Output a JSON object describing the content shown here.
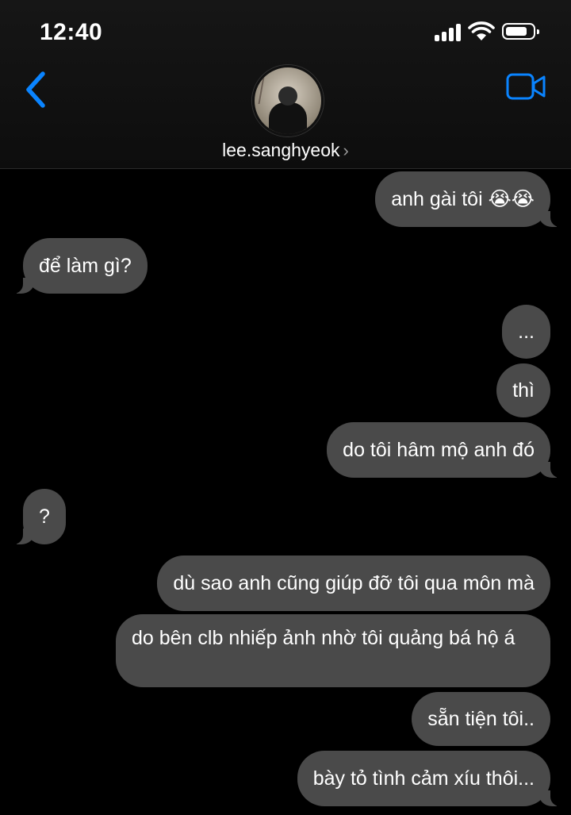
{
  "status_bar": {
    "time": "12:40"
  },
  "header": {
    "contact_name": "lee.sanghyeok",
    "chevron": "›"
  },
  "icons": {
    "back": "chevron-left-icon",
    "video": "video-camera-icon",
    "signal": "cellular-signal-icon",
    "wifi": "wifi-icon",
    "battery": "battery-icon"
  },
  "colors": {
    "accent": "#0a84ff",
    "bubble": "#4a4a4a",
    "background": "#000000"
  },
  "messages": [
    {
      "sender": "me",
      "text": "anh gài tôi 😭😭"
    },
    {
      "sender": "them",
      "text": "để làm gì?"
    },
    {
      "sender": "me",
      "text": "..."
    },
    {
      "sender": "me",
      "text": "thì"
    },
    {
      "sender": "me",
      "text": "do tôi hâm mộ anh đó"
    },
    {
      "sender": "them",
      "text": "?"
    },
    {
      "sender": "me",
      "text": "dù sao anh cũng giúp đỡ tôi qua môn mà"
    },
    {
      "sender": "me",
      "text": "do bên clb nhiếp ảnh nhờ tôi quảng bá hộ á"
    },
    {
      "sender": "me",
      "text": "sẵn tiện tôi.."
    },
    {
      "sender": "me",
      "text": "bày tỏ tình cảm xíu thôi..."
    }
  ]
}
